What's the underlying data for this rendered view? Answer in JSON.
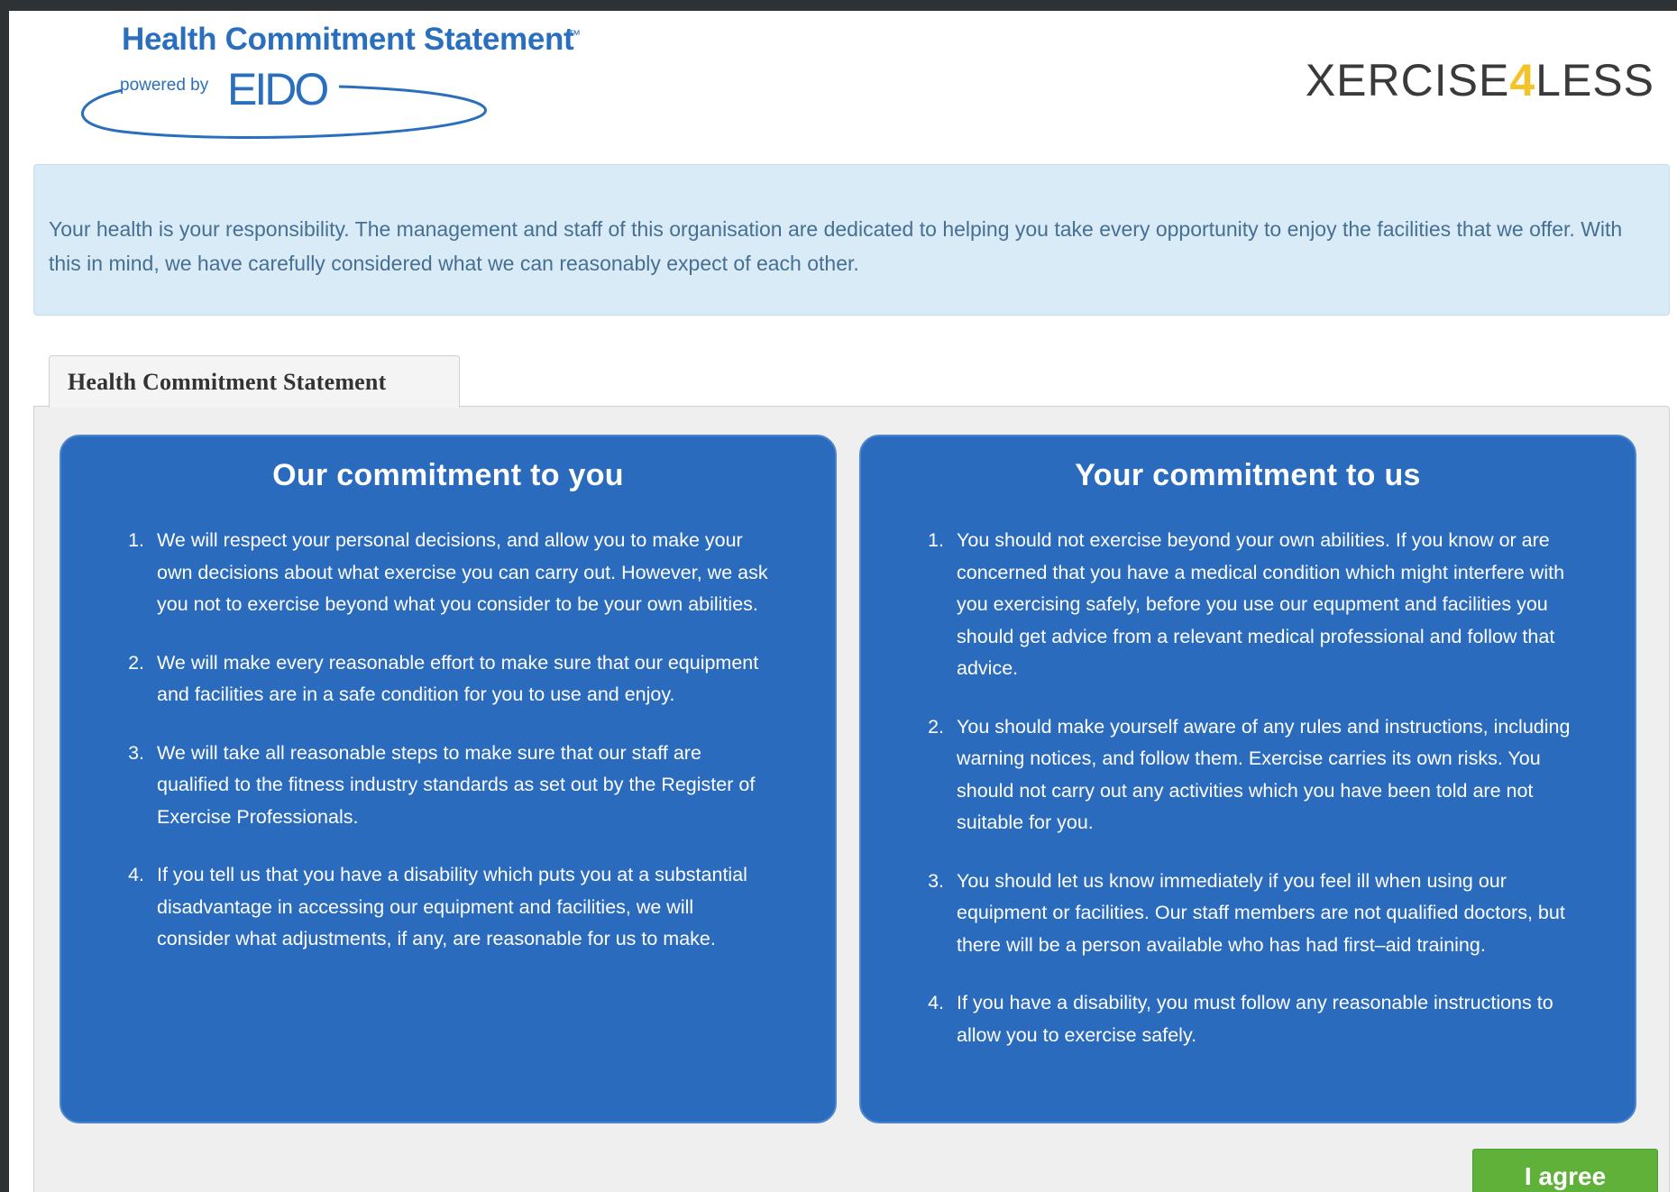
{
  "header": {
    "hcs_title": "Health Commitment Statement",
    "hcs_tm": "™",
    "powered_by": "powered by",
    "eido": "EIDO",
    "brand_part1": "XERCISE",
    "brand_four": "4",
    "brand_part2": "LESS"
  },
  "intro": {
    "text": "Your health is your responsibility. The management and staff of this organisation are dedicated to helping you take every opportunity to enjoy the facilities that we offer. With this in mind, we have carefully considered what we can reasonably expect of each other."
  },
  "tabs": [
    {
      "label": "Health Commitment Statement"
    }
  ],
  "our_commitment": {
    "title": "Our commitment to you",
    "items": [
      "We will respect your personal decisions, and allow you to make your own decisions about what exercise you can carry out. However, we ask you not to exercise beyond what you consider to be your own abilities.",
      "We will make every reasonable effort to make sure that our equipment and facilities are in a safe condition for you to use and enjoy.",
      "We will take all reasonable steps to make sure that our staff are qualified to the fitness industry standards as set out by the Register of Exercise Professionals.",
      "If you tell us that you have a disability which puts you at a substantial disadvantage in accessing our equipment and facilities, we will consider what adjustments, if any, are reasonable for us to make."
    ]
  },
  "your_commitment": {
    "title": "Your commitment to us",
    "items": [
      "You should not exercise beyond your own abilities. If you know or are concerned that you have a medical condition which might interfere with you exercising safely, before you use our equpment and facilities you should get advice from a relevant medical professional and follow that advice.",
      "You should make yourself aware of any rules and instructions, including warning notices, and follow them. Exercise carries its own risks. You should not carry out any activities which you have been told are not suitable for you.",
      "You should let us know immediately if you feel ill when using our equipment or facilities. Our staff members are not qualified doctors, but there will be a person available who has had first–aid training.",
      "If you have a disability, you must follow any reasonable instructions to allow you to exercise safely."
    ]
  },
  "actions": {
    "agree_label": "I agree"
  },
  "colors": {
    "card_blue": "#2a6bbd",
    "agree_green": "#5fb13a",
    "info_bg": "#d9ebf6",
    "brand_accent": "#f3c32a"
  }
}
